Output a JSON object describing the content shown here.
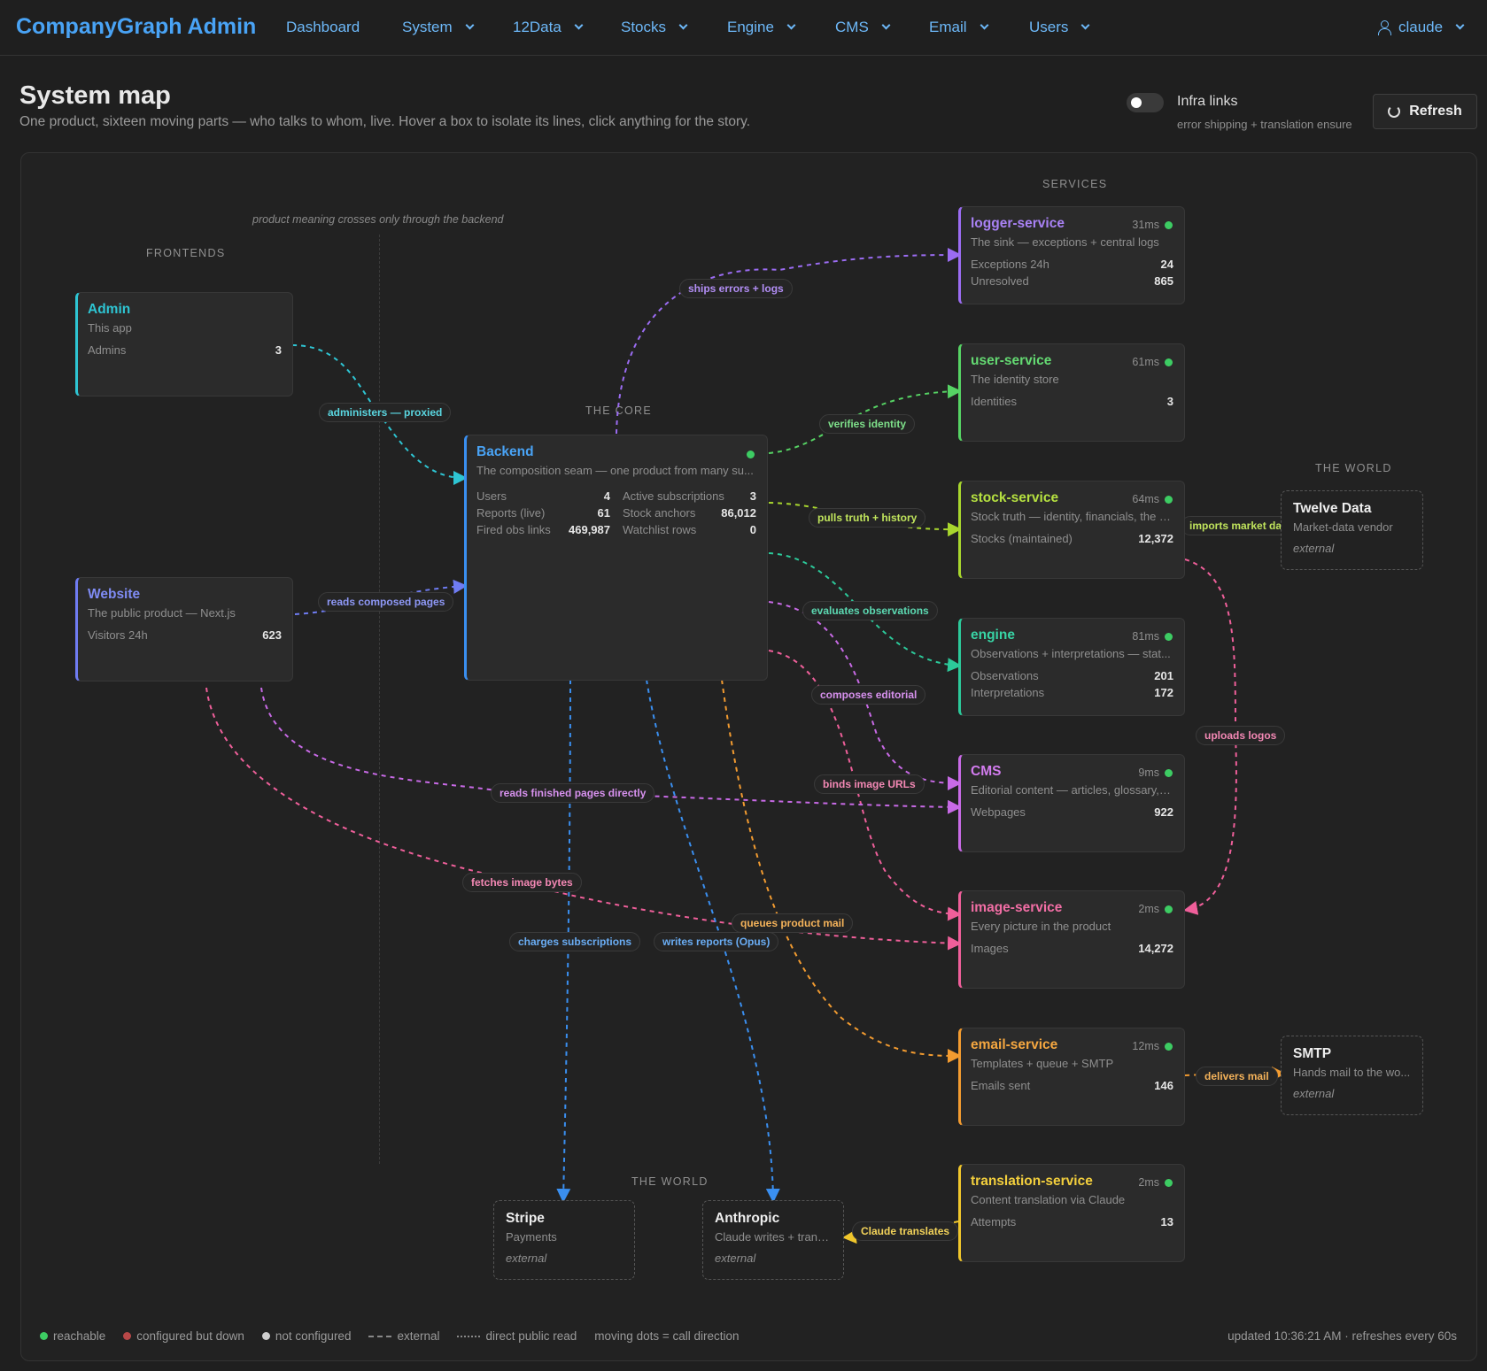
{
  "nav": {
    "brand": "CompanyGraph Admin",
    "items": [
      {
        "label": "Dashboard"
      },
      {
        "label": "System"
      },
      {
        "label": "12Data"
      },
      {
        "label": "Stocks"
      },
      {
        "label": "Engine"
      },
      {
        "label": "CMS"
      },
      {
        "label": "Email"
      },
      {
        "label": "Users"
      }
    ],
    "user": "claude"
  },
  "header": {
    "title": "System map",
    "subtitle": "One product, sixteen moving parts — who talks to whom, live. Hover a box to isolate its lines, click anything for the story.",
    "toggle_label": "Infra links",
    "toggle_sub": "error shipping + translation ensure",
    "refresh_label": "Refresh"
  },
  "sections": {
    "frontends": "FRONTENDS",
    "core": "THE CORE",
    "services": "SERVICES",
    "world_right": "THE WORLD",
    "world_bottom": "THE WORLD",
    "divider_note": "product meaning crosses only through the backend"
  },
  "colors": {
    "cyan": "#2ec5d3",
    "indigo": "#6f7cf2",
    "blue": "#3a8ff0",
    "purple": "#9b6cf2",
    "green": "#56d364",
    "lime": "#a8d62e",
    "teal": "#2cc99a",
    "magenta": "#c86ae6",
    "pink": "#ef5f9a",
    "orange": "#f29b30",
    "yellow": "#f0c62c"
  },
  "nodes": {
    "admin": {
      "title": "Admin",
      "sub": "This app",
      "stats": [
        {
          "k": "Admins",
          "v": "3"
        }
      ]
    },
    "website": {
      "title": "Website",
      "sub": "The public product — Next.js",
      "stats": [
        {
          "k": "Visitors 24h",
          "v": "623"
        }
      ]
    },
    "backend": {
      "title": "Backend",
      "sub": "The composition seam — one product from many su...",
      "stats_left": [
        {
          "k": "Users",
          "v": "4"
        },
        {
          "k": "Reports (live)",
          "v": "61"
        },
        {
          "k": "Fired obs links",
          "v": "469,987"
        }
      ],
      "stats_right": [
        {
          "k": "Active subscriptions",
          "v": "3"
        },
        {
          "k": "Stock anchors",
          "v": "86,012"
        },
        {
          "k": "Watchlist rows",
          "v": "0"
        }
      ]
    },
    "logger": {
      "title": "logger-service",
      "ms": "31ms",
      "sub": "The sink — exceptions + central logs",
      "stats": [
        {
          "k": "Exceptions 24h",
          "v": "24"
        },
        {
          "k": "Unresolved",
          "v": "865"
        }
      ]
    },
    "user": {
      "title": "user-service",
      "ms": "61ms",
      "sub": "The identity store",
      "stats": [
        {
          "k": "Identities",
          "v": "3"
        }
      ]
    },
    "stock": {
      "title": "stock-service",
      "ms": "64ms",
      "sub": "Stock truth — identity, financials, the fr...",
      "stats": [
        {
          "k": "Stocks (maintained)",
          "v": "12,372"
        }
      ]
    },
    "engine": {
      "title": "engine",
      "ms": "81ms",
      "sub": "Observations + interpretations — stat...",
      "stats": [
        {
          "k": "Observations",
          "v": "201"
        },
        {
          "k": "Interpretations",
          "v": "172"
        }
      ]
    },
    "cms": {
      "title": "CMS",
      "ms": "9ms",
      "sub": "Editorial content — articles, glossary, p...",
      "stats": [
        {
          "k": "Webpages",
          "v": "922"
        }
      ]
    },
    "image": {
      "title": "image-service",
      "ms": "2ms",
      "sub": "Every picture in the product",
      "stats": [
        {
          "k": "Images",
          "v": "14,272"
        }
      ]
    },
    "email": {
      "title": "email-service",
      "ms": "12ms",
      "sub": "Templates + queue + SMTP",
      "stats": [
        {
          "k": "Emails sent",
          "v": "146"
        }
      ]
    },
    "translation": {
      "title": "translation-service",
      "ms": "2ms",
      "sub": "Content translation via Claude",
      "stats": [
        {
          "k": "Attempts",
          "v": "13"
        }
      ]
    },
    "twelvedata": {
      "title": "Twelve Data",
      "sub": "Market-data vendor",
      "tag": "external"
    },
    "smtp": {
      "title": "SMTP",
      "sub": "Hands mail to the wo...",
      "tag": "external"
    },
    "stripe": {
      "title": "Stripe",
      "sub": "Payments",
      "tag": "external"
    },
    "anthropic": {
      "title": "Anthropic",
      "sub": "Claude writes + trans...",
      "tag": "external"
    }
  },
  "edges": {
    "administers": "administers — proxied",
    "reads_composed": "reads composed pages",
    "ships_errors": "ships errors + logs",
    "verifies_identity": "verifies identity",
    "pulls_truth": "pulls truth + history",
    "imports_market": "imports market data",
    "evaluates_obs": "evaluates observations",
    "composes_editorial": "composes editorial",
    "binds_image": "binds image URLs",
    "reads_finished": "reads finished pages directly",
    "fetches_image": "fetches image bytes",
    "queues_mail": "queues product mail",
    "uploads_logos": "uploads logos",
    "charges_subs": "charges subscriptions",
    "writes_reports": "writes reports (Opus)",
    "delivers_mail": "delivers mail",
    "claude_translates": "Claude translates"
  },
  "legend": {
    "reachable": "reachable",
    "down": "configured but down",
    "not_configured": "not configured",
    "external": "external",
    "direct_read": "direct public read",
    "moving_dots": "moving dots = call direction",
    "updated": "updated 10:36:21 AM · refreshes every 60s"
  }
}
